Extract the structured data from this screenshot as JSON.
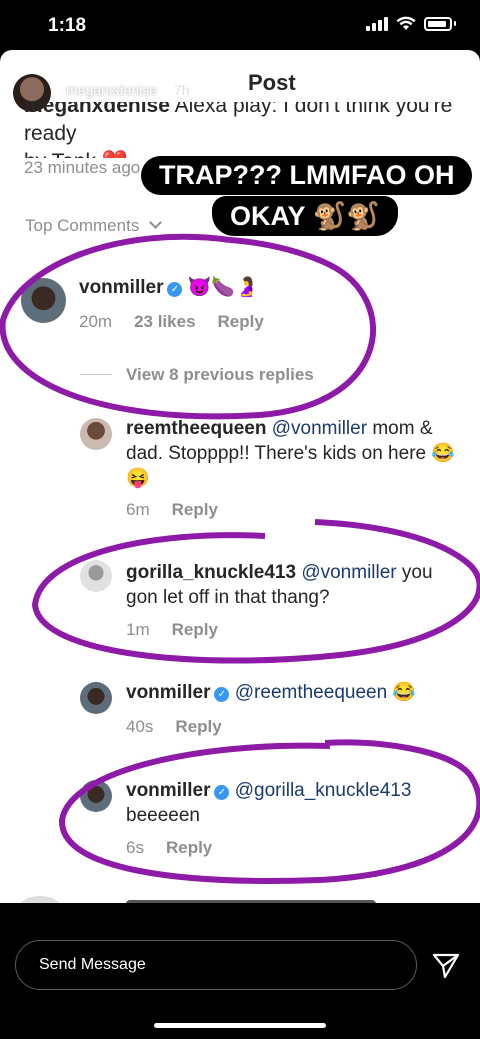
{
  "status": {
    "time": "1:18"
  },
  "story": {
    "username": "meganxdenise",
    "time": "7h",
    "title": "Post"
  },
  "caption": {
    "user": "meganxdenise",
    "text": " Alexa play: I don't think you're ready",
    "line2": "by Tank ❤️",
    "time": "23 minutes ago"
  },
  "top_comments_label": "Top Comments",
  "overlay": {
    "line1": "TRAP??? LMMFAO OH",
    "line2": "OKAY 🐒🐒"
  },
  "comments": [
    {
      "user": "vonmiller",
      "verified": true,
      "text": " 😈🍆🤰",
      "time": "20m",
      "likes": "23 likes",
      "reply": "Reply"
    },
    {
      "user": "reemtheequeen",
      "mention": "@vonmiller",
      "text": " mom & dad. Stopppp!! There's kids on here 😂😝",
      "time": "6m",
      "reply": "Reply"
    },
    {
      "user": "gorilla_knuckle413",
      "mention": "@vonmiller",
      "text": " you gon let off in that thang?",
      "time": "1m",
      "reply": "Reply"
    },
    {
      "user": "vonmiller",
      "mention": "@reemtheequeen",
      "text": " 😂",
      "time": "40s",
      "reply": "Reply"
    },
    {
      "user": "vonmiller",
      "mention": "@gorilla_knuckle413",
      "text": "beeeeen",
      "time": "6s",
      "reply": "Reply"
    }
  ],
  "view_replies": "View 8 previous replies",
  "bottom": {
    "placeholder": "Send Message"
  },
  "colors": {
    "circle": "#8e1aa8",
    "verified": "#3897f0",
    "mention": "#1a3b6e"
  },
  "icons": [
    "signal-icon",
    "wifi-icon",
    "battery-icon",
    "more-icon",
    "close-icon",
    "chevron-down-icon",
    "verified-icon",
    "send-icon"
  ]
}
